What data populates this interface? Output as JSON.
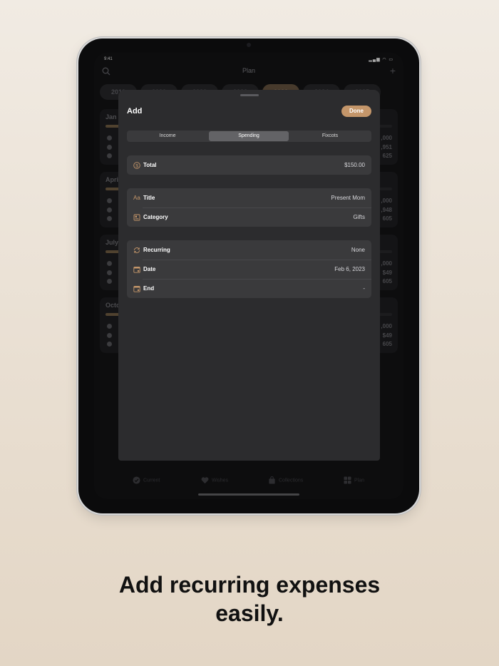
{
  "status_bar": {
    "time": "9:41"
  },
  "nav": {
    "title": "Plan"
  },
  "years": [
    "2019",
    "2020",
    "2021",
    "2022",
    "2023",
    "2024",
    "2025"
  ],
  "background_cards": [
    {
      "month": "Jan",
      "fill": 0.95,
      "values": [
        ",000",
        ",951",
        "625"
      ]
    },
    {
      "month": "Apri",
      "fill": 0.08,
      "values": [
        ",000",
        ",948",
        "605"
      ]
    },
    {
      "month": "July",
      "fill": 0.08,
      "values": [
        ",000",
        "$49",
        "605"
      ]
    },
    {
      "month": "Octo",
      "fill": 0.08,
      "values": [
        ",000",
        "$49",
        "605"
      ]
    }
  ],
  "tabs": [
    {
      "label": "Current",
      "icon": "check-circle-icon"
    },
    {
      "label": "Wishes",
      "icon": "heart-icon"
    },
    {
      "label": "Collections",
      "icon": "bag-icon"
    },
    {
      "label": "Plan",
      "icon": "grid-icon"
    }
  ],
  "sheet": {
    "title": "Add",
    "done_label": "Done",
    "segments": [
      "Income",
      "Spending",
      "Fixcots"
    ],
    "active_segment": "Spending",
    "total": {
      "label": "Total",
      "value": "$150.00"
    },
    "details": [
      {
        "label": "Title",
        "value": "Present Mom",
        "icon": "text-format-icon"
      },
      {
        "label": "Category",
        "value": "Gifts",
        "icon": "category-icon"
      }
    ],
    "schedule": [
      {
        "label": "Recurring",
        "value": "None",
        "icon": "repeat-icon"
      },
      {
        "label": "Date",
        "value": "Feb 6, 2023",
        "icon": "calendar-icon"
      },
      {
        "label": "End",
        "value": "-",
        "icon": "calendar-end-icon"
      }
    ]
  },
  "caption": {
    "line1": "Add recurring expenses",
    "line2": "easily."
  },
  "colors": {
    "accent": "#c4966a",
    "sheet_bg": "#2c2c2e",
    "row_bg": "#3a3a3c"
  }
}
